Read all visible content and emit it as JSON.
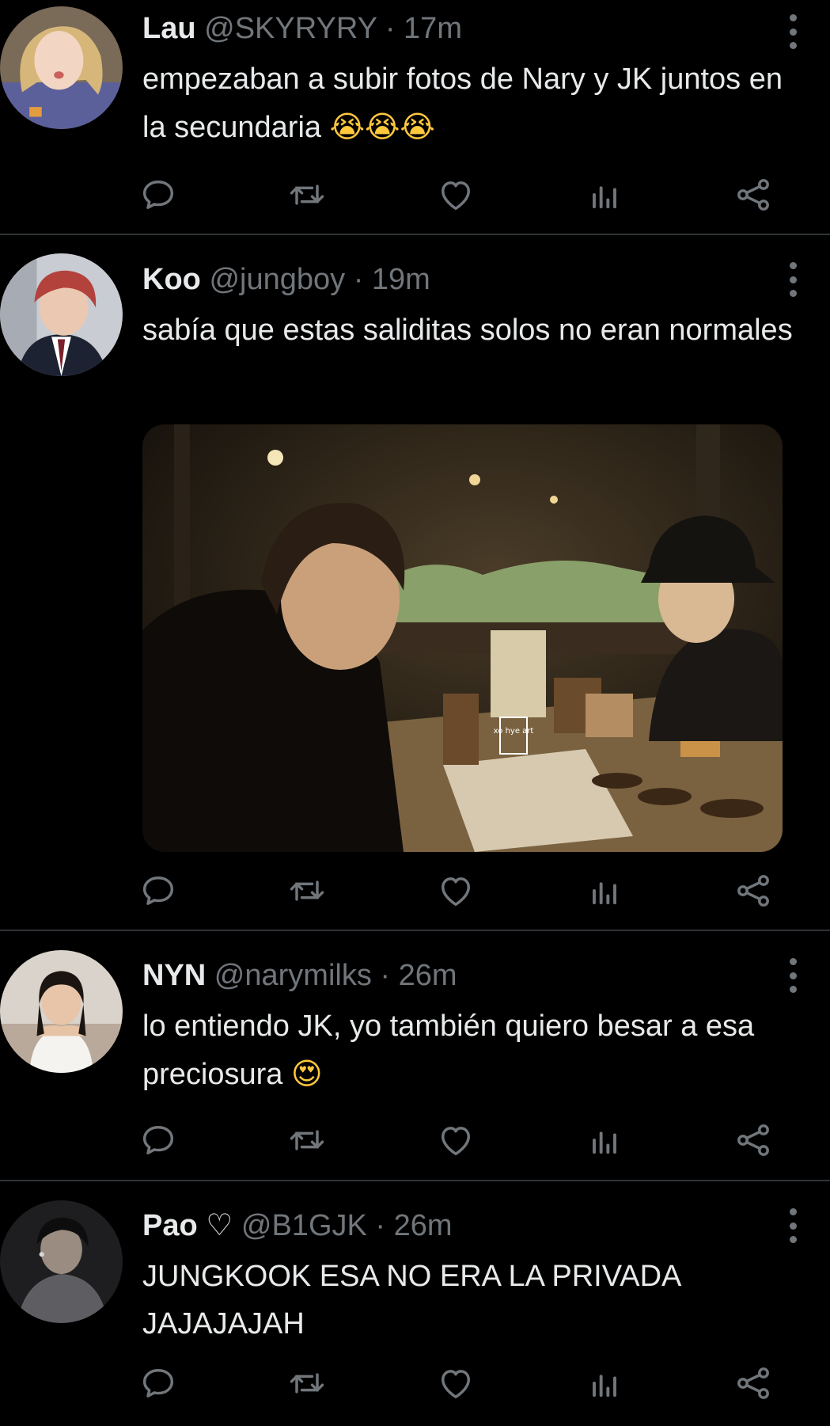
{
  "tweets": [
    {
      "name": "Lau",
      "handle": "@SKYRYRY",
      "separator": "·",
      "time": "17m",
      "text": "empezaban a subir fotos de Nary y JK juntos en la secundaria",
      "emoji": "😭😭😭",
      "avatar_icon": "avatar-blonde-girl"
    },
    {
      "name": "Koo",
      "handle": "@jungboy",
      "separator": "·",
      "time": "19m",
      "text": "sabía que estas saliditas solos no eran normales",
      "emoji": "",
      "avatar_icon": "avatar-red-hair-boy",
      "media": {
        "watermark": "xo hye art"
      }
    },
    {
      "name": "NYN",
      "handle": "@narymilks",
      "separator": "·",
      "time": "26m",
      "text": "lo entiendo JK, yo también quiero besar a esa preciosura",
      "emoji": "😍",
      "avatar_icon": "avatar-girl-white-top"
    },
    {
      "name": "Pao ♡",
      "handle": "@B1GJK",
      "separator": "·",
      "time": "26m",
      "text": "JUNGKOOK ESA NO ERA LA PRIVADA JAJAJAJAH",
      "emoji": "",
      "avatar_icon": "avatar-dark-photo"
    }
  ],
  "actions": [
    "reply-icon",
    "retweet-icon",
    "like-icon",
    "analytics-icon",
    "share-icon"
  ],
  "colors": {
    "background": "#000000",
    "text": "#e7e9ea",
    "secondary": "#71767b",
    "divider": "#2f3336"
  }
}
